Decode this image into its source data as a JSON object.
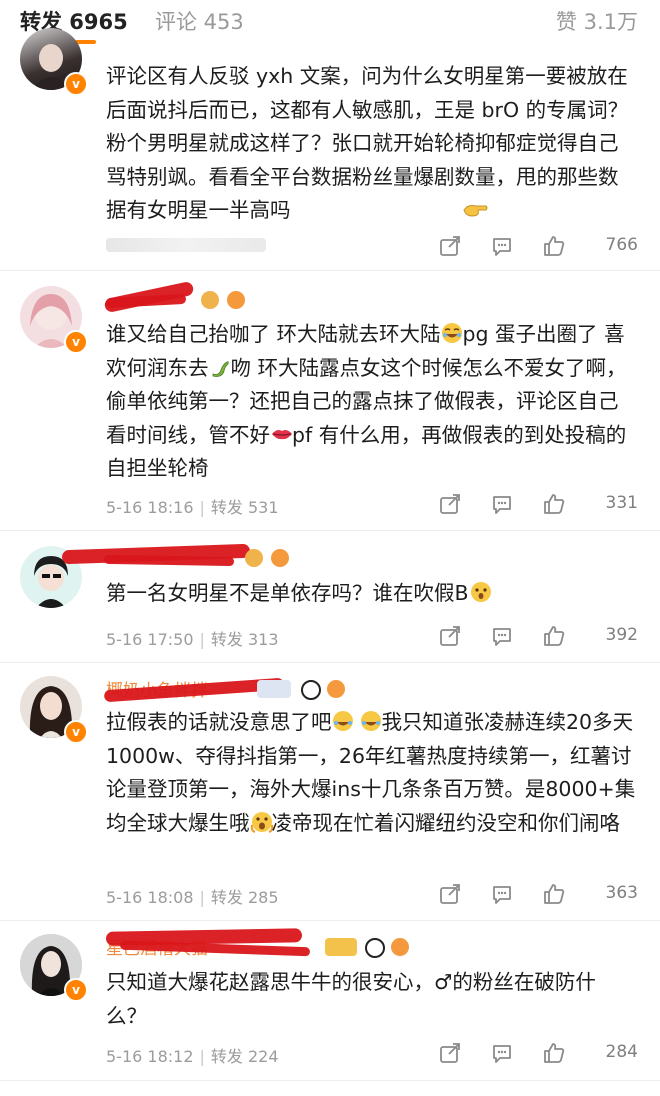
{
  "tabs": {
    "reposts": "转发 6965",
    "comments": "评论 453",
    "likes": "赞 3.1万"
  },
  "comments": [
    {
      "text": "评论区有人反驳 yxh 文案，问为什么女明星第一要被放在后面说抖后而已，这都有人敏感肌，王是 brO 的专属词？粉个男明星就成这样了？张口就开始轮椅抑郁症觉得自己骂特别飒。看看全平台数据粉丝量爆剧数量，甩的那些数据有女明星一半高吗",
      "likes": "766"
    },
    {
      "text_a": "谁又给自己抬咖了 环大陆就去环大陆",
      "text_b": "pg 蛋子出圈了 喜欢何润东去",
      "text_c": "吻 环大陆露点女这个时候怎么不爱女了啊，偷单依纯第一？还把自己的露点抹了做假表，评论区自己看时间线，管不好",
      "text_d": "pf 有什么用，再做假表的到处投稿的自担坐轮椅",
      "date": "5-16 18:16",
      "repost": "转发 531",
      "likes": "331"
    },
    {
      "text": "第一名女明星不是单依存吗？谁在吹假B",
      "date": "5-16 17:50",
      "repost": "转发 313",
      "likes": "392"
    },
    {
      "username": "椰奶小鱼拌拌",
      "text_a": "拉假表的话就没意思了吧",
      "text_b": "我只知道张凌赫连续20多天1000w、夺得抖指第一，26年红薯热度持续第一，红薯讨论量登顶第一，海外大爆ins十几条条百万赞。是8000+集均全球大爆生哦",
      "text_c": "凌帝现在忙着闪耀纽约没空和你们闹咯",
      "date": "5-16 18:08",
      "repost": "转发 285",
      "likes": "363"
    },
    {
      "username": "星巴酒槽大猫",
      "text": "只知道大爆花赵露思牛牛的很安心，♂的粉丝在破防什么？",
      "date": "5-16 18:12",
      "repost": "转发 224",
      "likes": "284"
    }
  ],
  "icons": {
    "repost": "share-icon",
    "comment": "comment-icon",
    "like": "thumb-up-icon",
    "verified": "v-badge-icon"
  },
  "colors": {
    "accent": "#ff8200",
    "redaction": "#d9161a"
  }
}
